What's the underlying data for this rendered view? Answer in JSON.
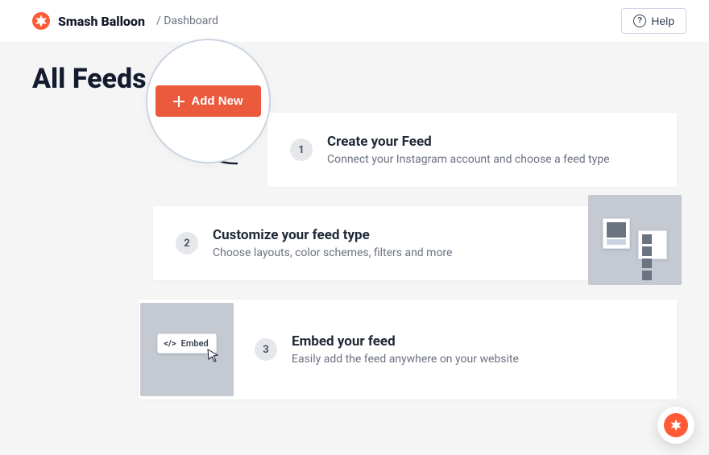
{
  "header": {
    "brand_name": "Smash Balloon",
    "breadcrumb": "/ Dashboard",
    "help_label": "Help"
  },
  "page": {
    "title": "All Feeds",
    "add_new_label": "Add New"
  },
  "steps": [
    {
      "number": "1",
      "title": "Create your Feed",
      "desc": "Connect your Instagram account and choose a feed type"
    },
    {
      "number": "2",
      "title": "Customize your feed type",
      "desc": "Choose layouts, color schemes, filters and more"
    },
    {
      "number": "3",
      "title": "Embed your feed",
      "desc": "Easily add the feed anywhere on your website"
    }
  ],
  "embed_chip_label": "Embed"
}
